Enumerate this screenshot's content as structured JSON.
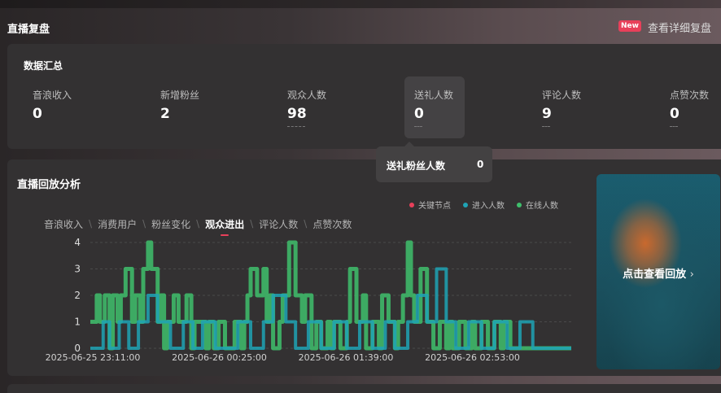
{
  "header": {
    "title": "直播复盘",
    "badge": "New",
    "detail_link": "查看详细复盘"
  },
  "summary": {
    "title": "数据汇总",
    "metrics": [
      {
        "label": "音浪收入",
        "value": "0"
      },
      {
        "label": "新增粉丝",
        "value": "2"
      },
      {
        "label": "观众人数",
        "value": "98"
      },
      {
        "label": "送礼人数",
        "value": "0"
      },
      {
        "label": "评论人数",
        "value": "9"
      },
      {
        "label": "点赞次数",
        "value": "0"
      }
    ],
    "tooltip": {
      "label": "送礼粉丝人数",
      "value": "0"
    }
  },
  "replay": {
    "title": "直播回放分析",
    "legend": [
      {
        "name": "关键节点",
        "color": "#e8405a"
      },
      {
        "name": "进入人数",
        "color": "#1fa3b5"
      },
      {
        "name": "在线人数",
        "color": "#3fbf6c"
      }
    ],
    "tabs": [
      "音浪收入",
      "消费用户",
      "粉丝变化",
      "观众进出",
      "评论人数",
      "点赞次数"
    ],
    "active_tab": "观众进出",
    "thumbnail_cta": "点击查看回放",
    "thumbnail_icon": "chevron-right-icon"
  },
  "chart_data": {
    "type": "line",
    "x_tick_labels": [
      "2025-06-25 23:11:00",
      "2025-06-26 00:25:00",
      "2025-06-26 01:39:00",
      "2025-06-26 02:53:00"
    ],
    "ylim": [
      0,
      4
    ],
    "y_ticks": [
      0,
      1,
      2,
      3,
      4
    ],
    "grid": true,
    "x_range_minutes": [
      0,
      300
    ],
    "series": [
      {
        "name": "在线人数",
        "color": "#3fbf6c",
        "x_minutes": [
          0,
          4,
          6,
          9,
          12,
          14,
          17,
          19,
          22,
          26,
          28,
          31,
          33,
          36,
          38,
          42,
          44,
          46,
          48,
          52,
          55,
          58,
          60,
          63,
          65,
          68,
          72,
          74,
          77,
          80,
          84,
          86,
          90,
          94,
          96,
          98,
          100,
          104,
          108,
          110,
          112,
          114,
          118,
          120,
          124,
          128,
          132,
          134,
          138,
          141,
          144,
          148,
          150,
          152,
          156,
          160,
          162,
          166,
          170,
          172,
          176,
          180,
          182,
          186,
          190,
          192,
          195,
          198,
          200,
          202,
          206,
          210,
          214,
          218,
          222,
          224,
          226,
          230,
          234,
          238,
          240,
          244,
          248,
          252,
          256,
          258,
          262,
          266,
          270,
          272,
          276,
          280,
          300
        ],
        "values": [
          1,
          2,
          1,
          2,
          0,
          2,
          1,
          2,
          3,
          1,
          2,
          1,
          3,
          4,
          3,
          1,
          2,
          0,
          1,
          2,
          1,
          1,
          2,
          0,
          1,
          1,
          0,
          1,
          0,
          1,
          0,
          0,
          1,
          0,
          1,
          2,
          3,
          2,
          3,
          1,
          2,
          0,
          1,
          2,
          4,
          2,
          1,
          2,
          0,
          1,
          0,
          1,
          0,
          1,
          0,
          1,
          3,
          1,
          2,
          0,
          1,
          0,
          2,
          1,
          0,
          1,
          2,
          4,
          2,
          1,
          3,
          1,
          0,
          1,
          0,
          1,
          0,
          1,
          0,
          1,
          0,
          1,
          0,
          1,
          0,
          1,
          0,
          0,
          0,
          0,
          0,
          0,
          0
        ]
      },
      {
        "name": "进入人数",
        "color": "#1fa3b5",
        "x_minutes": [
          0,
          8,
          12,
          18,
          24,
          30,
          36,
          42,
          50,
          58,
          64,
          70,
          78,
          84,
          92,
          100,
          108,
          114,
          122,
          128,
          136,
          144,
          152,
          160,
          168,
          176,
          184,
          190,
          198,
          204,
          210,
          216,
          222,
          228,
          236,
          244,
          252,
          260,
          268,
          276,
          284,
          300
        ],
        "values": [
          0,
          1,
          0,
          1,
          0,
          1,
          2,
          1,
          0,
          1,
          0,
          1,
          0,
          0,
          1,
          0,
          1,
          2,
          1,
          0,
          1,
          0,
          1,
          0,
          1,
          0,
          1,
          0,
          1,
          2,
          1,
          3,
          1,
          0,
          1,
          0,
          1,
          0,
          1,
          0,
          0,
          0
        ]
      }
    ]
  }
}
